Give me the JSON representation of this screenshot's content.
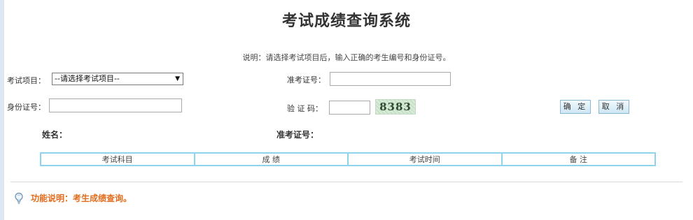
{
  "page": {
    "title": "考试成绩查询系统",
    "instructions": "说明：请选择考试项目后，输入正确的考生编号和身份证号。"
  },
  "form": {
    "exam_item_label": "考试项目：",
    "exam_item_selected": "--请选择考试项目--",
    "admission_label": "准考证号：",
    "admission_value": "",
    "id_label": "身份证号：",
    "id_value": "",
    "captcha_label": "验 证 码：",
    "captcha_value": "",
    "captcha_text": "8383",
    "confirm_label": "确 定",
    "cancel_label": "取 消"
  },
  "result": {
    "name_label": "姓名：",
    "admission_label": "准考证号："
  },
  "table": {
    "headers": [
      "考试科目",
      "成 绩",
      "考试时间",
      "备 注"
    ]
  },
  "footer": {
    "function_note": "功能说明：考生成绩查询。"
  },
  "colors": {
    "table_border": "#8fd3ea",
    "note_text": "#e36c1c",
    "button_border": "#8ab8d4"
  },
  "icons": {
    "footer": "lightbulb-icon",
    "select": "dropdown-arrow-icon"
  }
}
